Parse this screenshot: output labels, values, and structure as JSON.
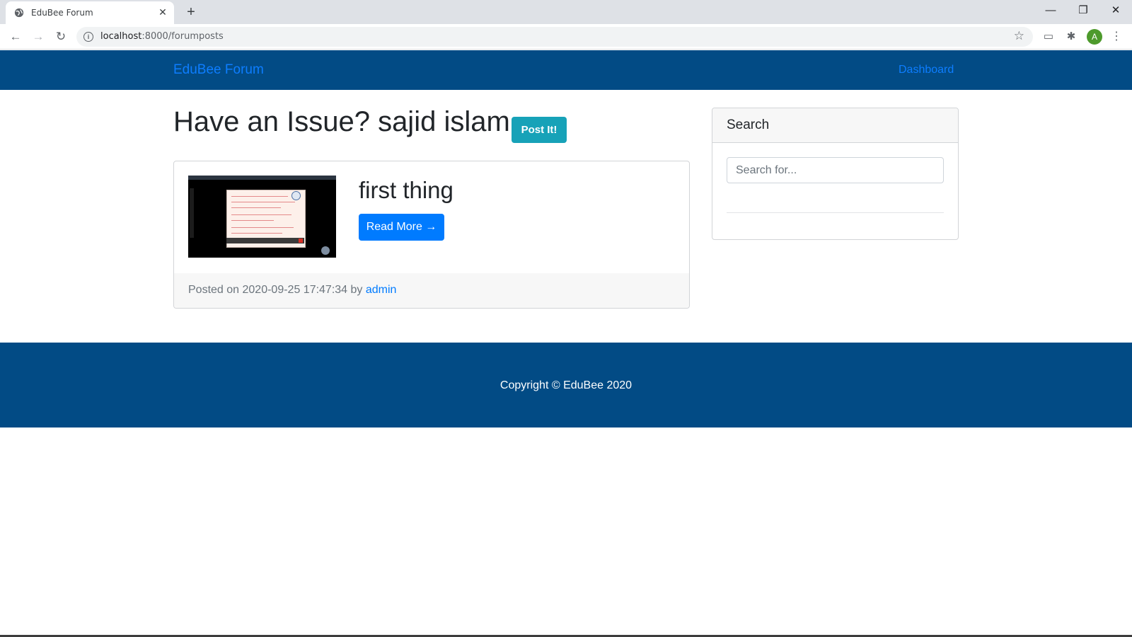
{
  "browser": {
    "tab_title": "EduBee Forum",
    "tab_close": "✕",
    "new_tab": "+",
    "url_host": "localhost",
    "url_path": ":8000/forumposts",
    "avatar_letter": "A",
    "window_controls": {
      "minimize": "—",
      "restore": "❐",
      "close": "✕"
    }
  },
  "navbar": {
    "brand": "EduBee Forum",
    "links": [
      {
        "label": "Dashboard"
      }
    ]
  },
  "main": {
    "heading": "Have an Issue? sajid islam",
    "post_button": "Post It!",
    "posts": [
      {
        "title": "first thing",
        "read_more": "Read More →",
        "posted_prefix": "Posted on 2020-09-25 17:47:34 by ",
        "author": "admin"
      }
    ]
  },
  "sidebar": {
    "search": {
      "title": "Search",
      "placeholder": "Search for..."
    }
  },
  "footer": {
    "copyright": "Copyright © EduBee 2020"
  },
  "colors": {
    "navbar_bg": "#024b85",
    "link": "#007bff",
    "post_button": "#17a2b8",
    "primary_button": "#007bff"
  }
}
